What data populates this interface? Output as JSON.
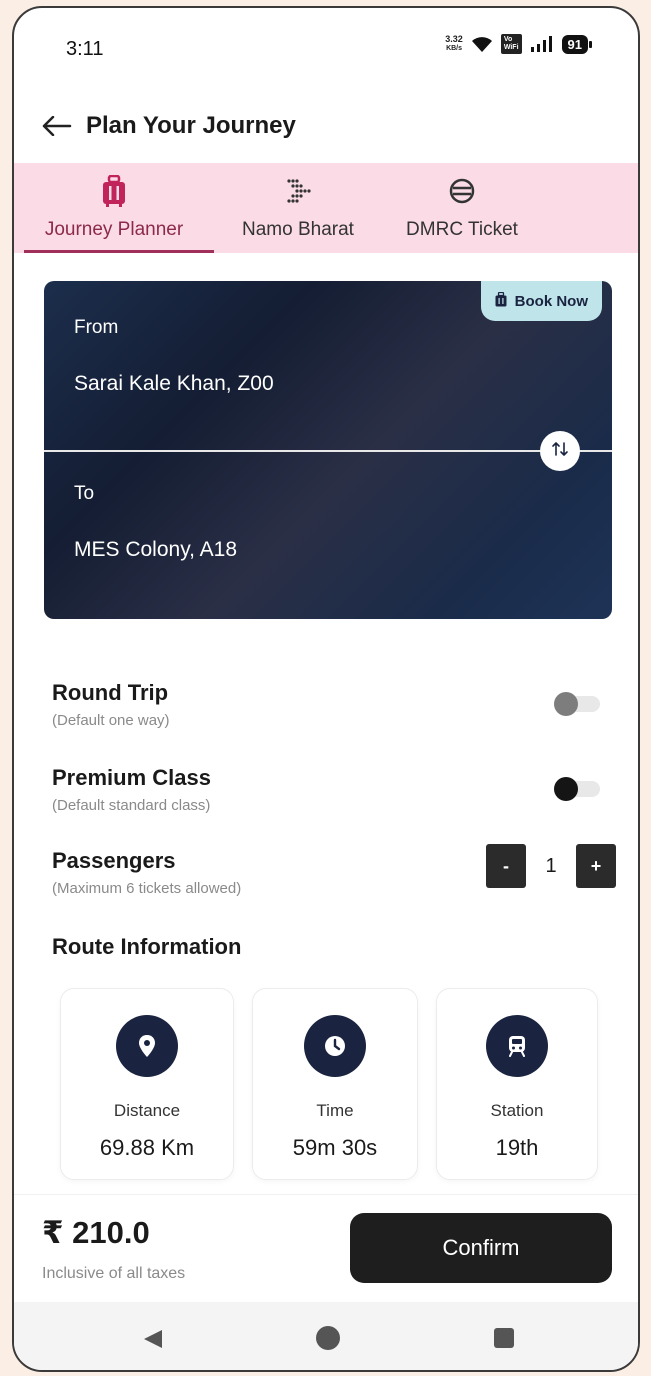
{
  "status_bar": {
    "time": "3:11",
    "net_speed_value": "3.32",
    "net_speed_unit": "KB/s",
    "vowifi_top": "Vo",
    "vowifi_bottom": "WiFi",
    "battery": "91",
    "icons": [
      "wifi-icon",
      "signal-icon",
      "battery-icon"
    ]
  },
  "header": {
    "title": "Plan Your Journey",
    "back_icon": "arrow-left-icon"
  },
  "tabs": [
    {
      "label": "Journey Planner",
      "icon": "luggage-icon",
      "active": true
    },
    {
      "label": "Namo Bharat",
      "icon": "namo-bharat-logo-icon",
      "active": false
    },
    {
      "label": "DMRC Ticket",
      "icon": "dmrc-logo-icon",
      "active": false
    }
  ],
  "journey": {
    "book_now_label": "Book Now",
    "from_label": "From",
    "from_value": "Sarai Kale Khan, Z00",
    "to_label": "To",
    "to_value": "MES Colony, A18",
    "swap_icon": "swap-vertical-icon"
  },
  "options": {
    "round_trip": {
      "title": "Round Trip",
      "subtitle": "(Default one way)",
      "enabled": false
    },
    "premium_class": {
      "title": "Premium Class",
      "subtitle": "(Default standard class)",
      "enabled": false
    },
    "passengers": {
      "title": "Passengers",
      "subtitle": "(Maximum 6 tickets allowed)",
      "minus": "-",
      "plus": "+",
      "count": "1"
    }
  },
  "route": {
    "title": "Route Information",
    "cards": [
      {
        "label": "Distance",
        "value": "69.88 Km",
        "icon": "location-pin-icon"
      },
      {
        "label": "Time",
        "value": "59m 30s",
        "icon": "clock-icon"
      },
      {
        "label": "Station",
        "value": "19th",
        "icon": "train-icon"
      }
    ]
  },
  "footer": {
    "price": "₹ 210.0",
    "price_note": "Inclusive of all taxes",
    "confirm_label": "Confirm"
  },
  "colors": {
    "card_bg": "#1a2440",
    "tab_bg": "#fbdbe5",
    "active_tab": "#a0305a",
    "book_now_bg": "#bfe4ea",
    "confirm_bg": "#1e1e1e"
  }
}
